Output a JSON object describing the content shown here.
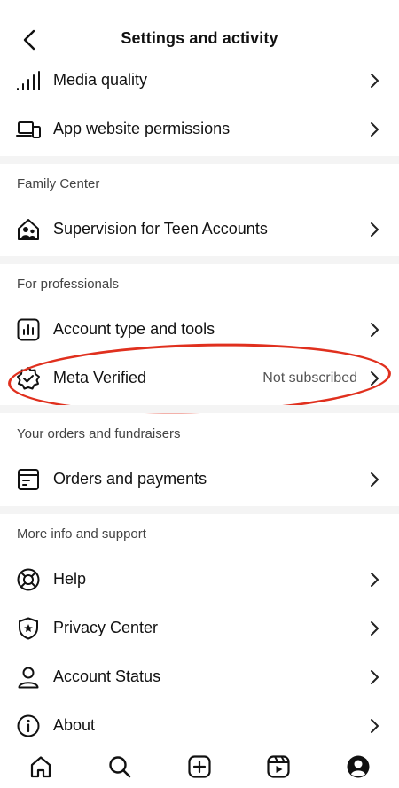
{
  "header": {
    "title": "Settings and activity",
    "back_icon": "chevron-left-icon"
  },
  "rows": {
    "media_quality": {
      "label": "Media quality",
      "icon": "signal-bars-icon"
    },
    "app_permissions": {
      "label": "App website permissions",
      "icon": "devices-icon"
    },
    "supervision": {
      "label": "Supervision for Teen Accounts",
      "icon": "family-home-icon"
    },
    "account_type": {
      "label": "Account type and tools",
      "icon": "bar-chart-icon"
    },
    "meta_verified": {
      "label": "Meta Verified",
      "value": "Not subscribed",
      "icon": "verified-badge-icon"
    },
    "orders": {
      "label": "Orders and payments",
      "icon": "receipt-icon"
    },
    "help": {
      "label": "Help",
      "icon": "lifebuoy-icon"
    },
    "privacy": {
      "label": "Privacy Center",
      "icon": "shield-star-icon"
    },
    "account_status": {
      "label": "Account Status",
      "icon": "person-icon"
    },
    "about": {
      "label": "About",
      "icon": "info-icon"
    }
  },
  "sections": {
    "family": "Family Center",
    "professionals": "For professionals",
    "orders": "Your orders and fundraisers",
    "support": "More info and support"
  },
  "highlight_color": "#e0301e",
  "tabbar": {
    "tabs": [
      "home-icon",
      "search-icon",
      "create-icon",
      "reels-icon",
      "profile-icon"
    ]
  }
}
